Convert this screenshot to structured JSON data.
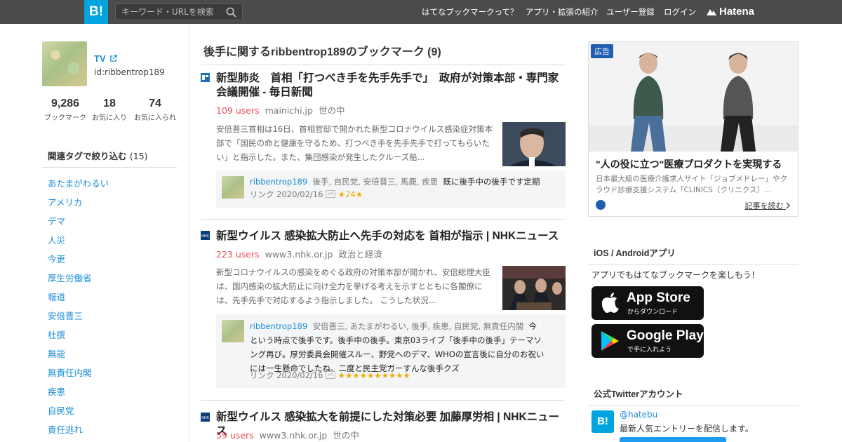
{
  "header": {
    "logo": "B!",
    "search_placeholder": "キーワード・URLを検索",
    "nav": [
      "はてなブックマークって？",
      "アプリ・拡張の紹介",
      "ユーザー登録",
      "ログイン"
    ],
    "brand": "Hatena"
  },
  "profile": {
    "name": "TV",
    "id": "id:ribbentrop189",
    "stats": [
      {
        "num": "9,286",
        "label": "ブックマーク"
      },
      {
        "num": "18",
        "label": "お気に入り"
      },
      {
        "num": "74",
        "label": "お気に入られ"
      }
    ]
  },
  "tags": {
    "heading": "関連タグで絞り込む",
    "count": "(15)",
    "items": [
      "あたまがわるい",
      "アメリカ",
      "デマ",
      "人災",
      "今更",
      "厚生労働省",
      "報道",
      "安倍晋三",
      "杜撰",
      "無能",
      "無責任内閣",
      "疾患",
      "自民党",
      "責任逃れ"
    ]
  },
  "main": {
    "title": "後手に関するribbentrop189のブックマーク (9)",
    "entries": [
      {
        "title": "新型肺炎　首相「打つべき手を先手先手で」　政府が対策本部・専門家会議開催 - 毎日新聞",
        "users": "109 users",
        "domain": "mainichi.jp",
        "category": "世の中",
        "summary": "安倍晋三首相は16日、首相官邸で開かれた新型コロナウイルス感染症対策本部で「国民の命と健康を守るため、打つべき手を先手先手で打ってもらいたい」と指示した。また、集団感染が発生したクルーズ船...",
        "comment_user": "ribbentrop189",
        "comment_tags": "後手, 自民党, 安倍晋三, 馬鹿, 疾患",
        "comment_body": "既に後手中の後手です定期",
        "link_label": "リンク",
        "date": "2020/02/16",
        "stars": "★24★"
      },
      {
        "title": "新型ウイルス 感染拡大防止へ先手の対応を 首相が指示 | NHKニュース",
        "users": "223 users",
        "domain": "www3.nhk.or.jp",
        "category": "政治と経済",
        "summary": "新型コロナウイルスの感染をめぐる政府の対策本部が開かれ、安倍総理大臣は、国内感染の拡大防止に向け全力を挙げる考えを示すとともに各閣僚には、先手先手で対応するよう指示しました。 こうした状況...",
        "comment_user": "ribbentrop189",
        "comment_tags": "安倍晋三, あたまがわるい, 後手, 疾患, 自民党, 無責任内閣",
        "comment_body": "今という時点で後手です。後手中の後手。東京03ライブ「後手中の後手」テーマソング再び。厚労委員会開催スルー、野党へのデマ、WHOの宣言後に自分のお祝いには一生懸命でしたね。二度と民主党ガーすんな後手クズ",
        "link_label": "リンク",
        "date": "2020/02/16",
        "stars": "★★★★★★★★★★"
      },
      {
        "title": "新型ウイルス 感染拡大を前提にした対策必要 加藤厚労相 | NHKニュース",
        "users": "59 users",
        "domain": "www3.nhk.or.jp",
        "category": "世の中"
      }
    ]
  },
  "ad": {
    "badge": "広告",
    "title": "\"人の役に立つ\"医療プロダクトを実現する",
    "desc": "日本最大級の医療介護求人サイト「ジョブメドレー」やクラウド診療支援システム「CLINICS（クリニクス）...",
    "link": "記事を読む"
  },
  "apps": {
    "heading": "iOS / Androidアプリ",
    "text": "アプリでもはてなブックマークを楽しもう！",
    "appstore_big": "App Store",
    "appstore_small": "からダウンロード",
    "googleplay_big": "Google Play",
    "googleplay_small": "で手に入れよう"
  },
  "twitter": {
    "heading": "公式Twitterアカウント",
    "logo": "B!",
    "handle": "@hatebu",
    "text": "最新人気エントリーを配信します。"
  }
}
